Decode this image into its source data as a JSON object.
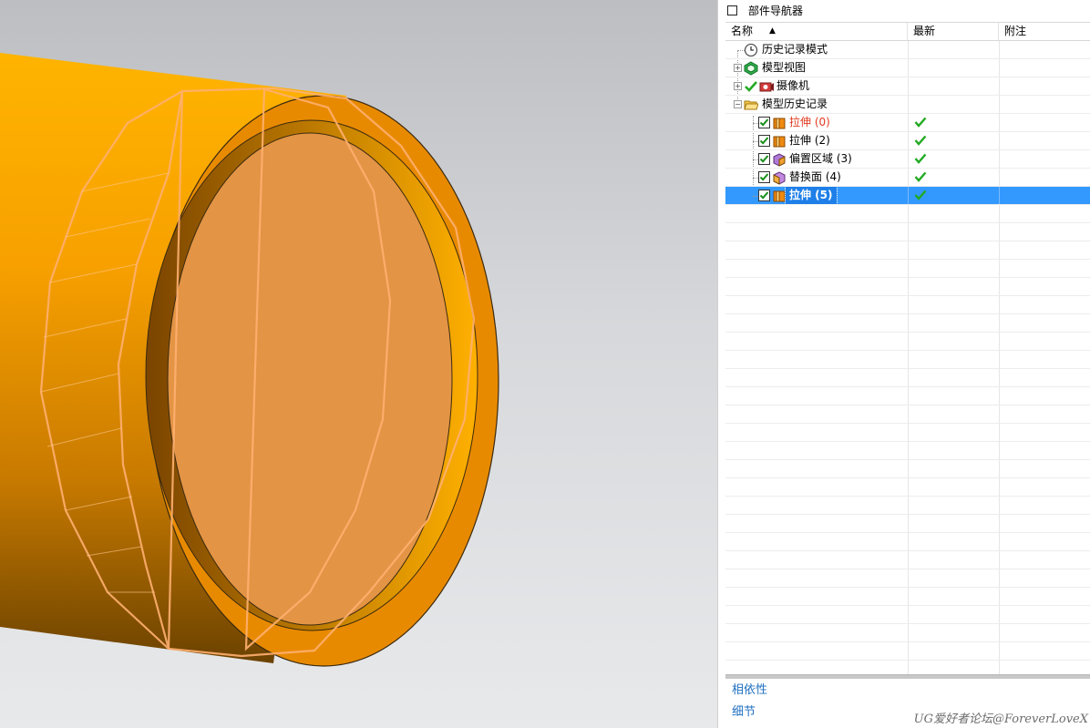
{
  "panel": {
    "title": "部件导航器"
  },
  "columns": {
    "name": "名称",
    "latest": "最新",
    "notes": "附注"
  },
  "tree": [
    {
      "label": "历史记录模式",
      "icon": "clock-icon",
      "latest": false
    },
    {
      "label": "模型视图",
      "icon": "model-views-icon",
      "latest": false,
      "expander": "+"
    },
    {
      "label": "摄像机",
      "icon": "camera-icon",
      "latest": false,
      "expander": "+"
    },
    {
      "label": "模型历史记录",
      "icon": "folder-open-icon",
      "latest": false,
      "expander": "−"
    },
    {
      "label": "拉伸 (0)",
      "icon": "extrude-icon",
      "latest": true,
      "color": "#e03a1e"
    },
    {
      "label": "拉伸 (2)",
      "icon": "extrude-icon",
      "latest": true
    },
    {
      "label": "偏置区域 (3)",
      "icon": "offset-region-icon",
      "latest": true
    },
    {
      "label": "替换面 (4)",
      "icon": "replace-face-icon",
      "latest": true
    },
    {
      "label": "拉伸 (5)",
      "icon": "extrude-icon",
      "latest": true,
      "selected": true
    }
  ],
  "sections": {
    "dependencies": "相依性",
    "details": "细节"
  },
  "watermark": "UG爱好者论坛@ForeverLoveX",
  "colors": {
    "selection": "#3399ff",
    "latest_check": "#22aa22",
    "model_orange": "#f0a020",
    "link_blue": "#1f6fc0"
  }
}
